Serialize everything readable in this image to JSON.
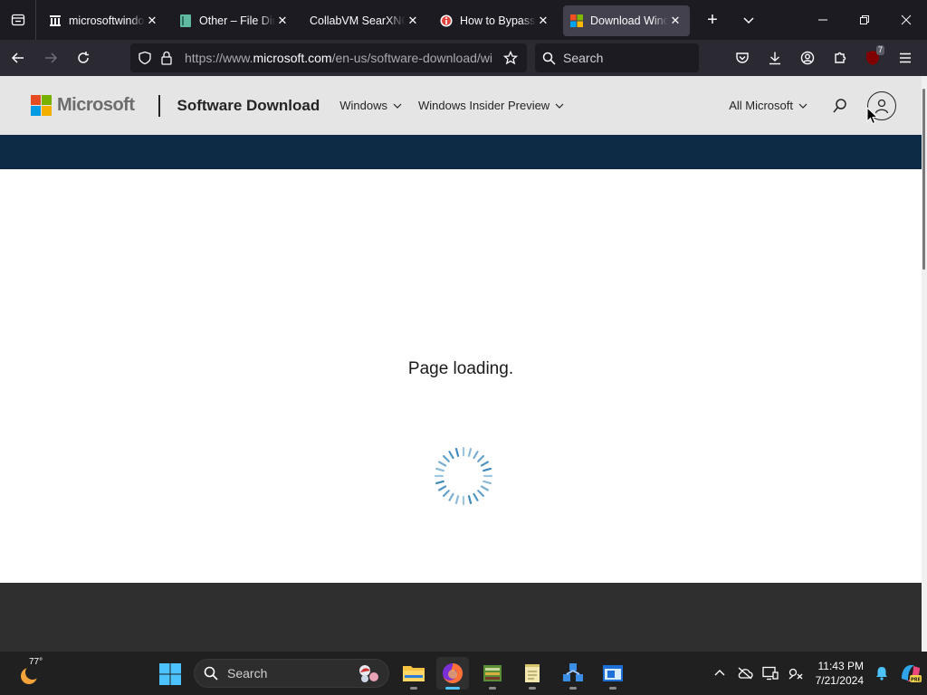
{
  "browser": {
    "tabs": [
      {
        "title": "microsoftwindows",
        "favicon": "archive-icon"
      },
      {
        "title": "Other – File Directory",
        "favicon": "book-icon"
      },
      {
        "title": "CollabVM SearXNG",
        "favicon": "none"
      },
      {
        "title": "How to Bypass Windows",
        "favicon": "info-icon"
      },
      {
        "title": "Download Windows",
        "favicon": "microsoft-icon",
        "active": true
      }
    ],
    "url_prefix": "https://www.",
    "url_domain": "microsoft.com",
    "url_path": "/en-us/software-download/windows",
    "search_placeholder": "Search",
    "extension_badge": "7"
  },
  "page": {
    "brand": "Microsoft",
    "section_title": "Software Download",
    "nav": [
      "Windows",
      "Windows Insider Preview"
    ],
    "all_microsoft": "All Microsoft",
    "loading_text": "Page loading.",
    "accent": "#0e2b46"
  },
  "taskbar": {
    "weather_temp": "77°",
    "search_placeholder": "Search",
    "time": "11:43 PM",
    "date": "7/21/2024"
  }
}
